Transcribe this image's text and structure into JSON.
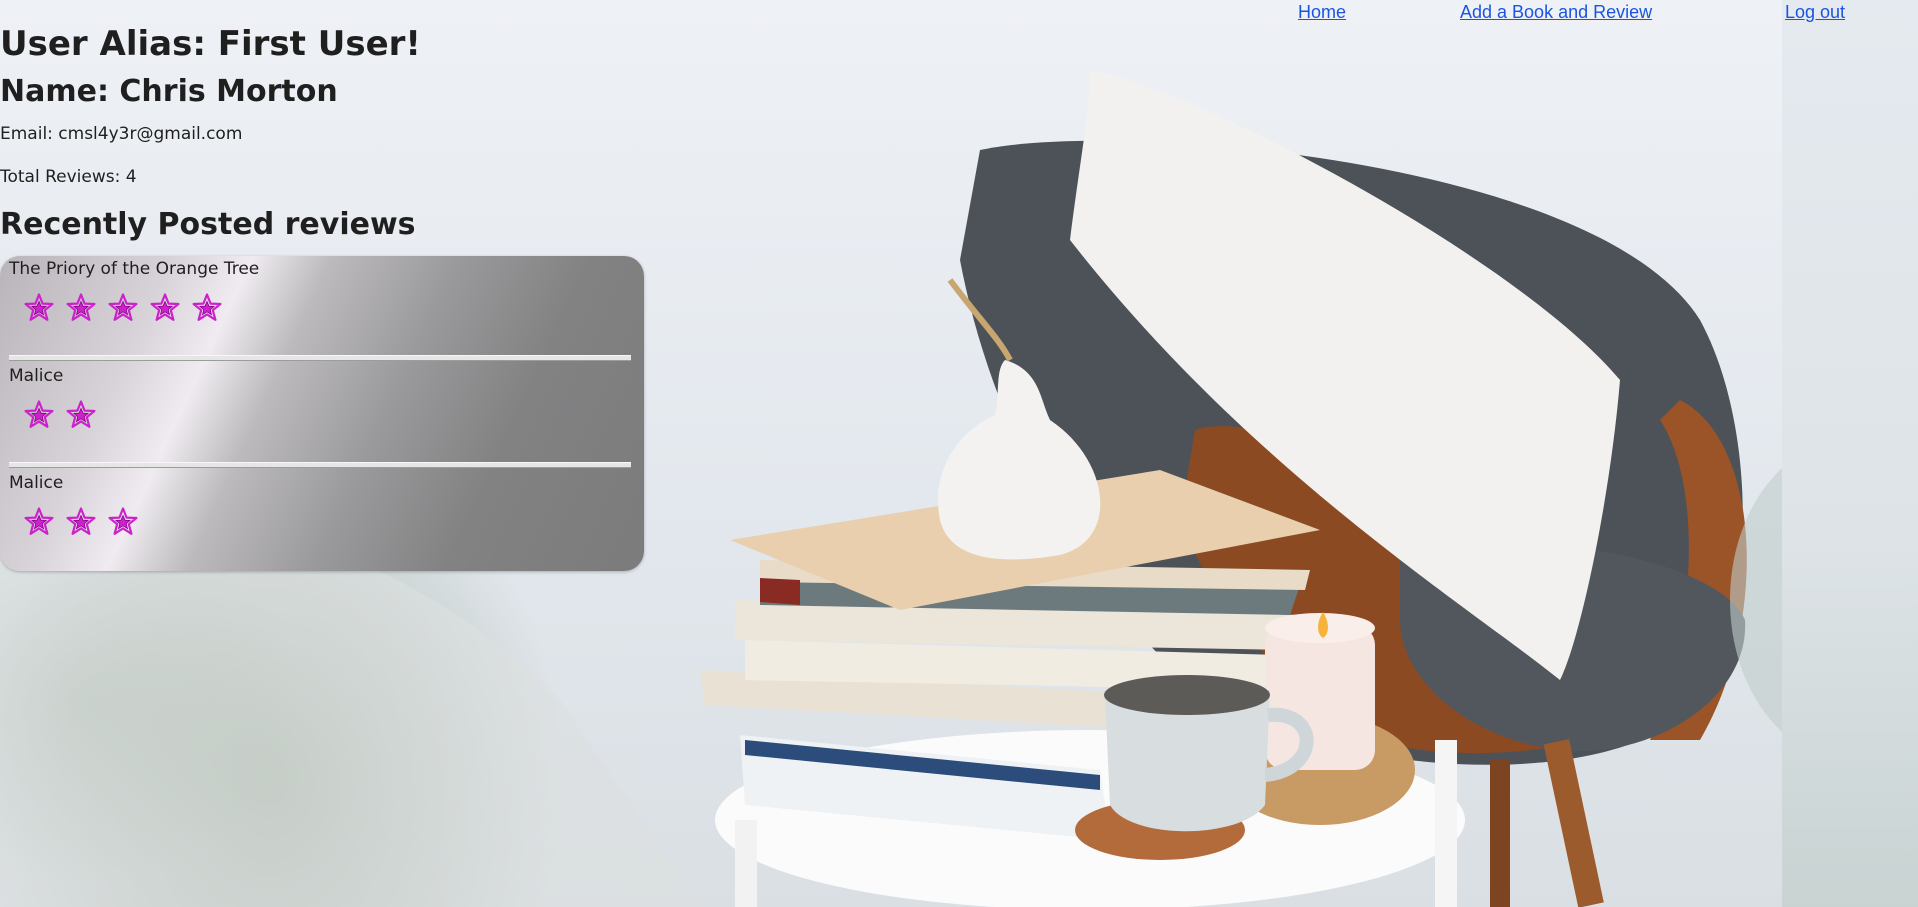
{
  "nav": {
    "home": "Home",
    "add_book": "Add a Book and Review",
    "logout": "Log out"
  },
  "profile": {
    "alias": "User Alias: First User!",
    "name": "Name: Chris Morton",
    "email": "Email: cmsl4y3r@gmail.com",
    "total_reviews": "Total Reviews: 4"
  },
  "recent": {
    "heading": "Recently Posted reviews",
    "reviews": [
      {
        "title": "The Priory of the Orange Tree",
        "rating": 5
      },
      {
        "title": "Malice",
        "rating": 2
      },
      {
        "title": "Malice",
        "rating": 3
      }
    ]
  },
  "colors": {
    "link": "#1a55e0",
    "star_fill": "#cc22cc",
    "star_stroke": "#8a008a"
  },
  "icons": {
    "rating": "star-icon"
  }
}
